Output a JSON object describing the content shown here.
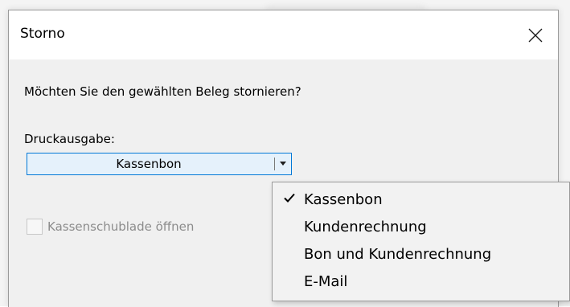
{
  "dialog": {
    "title": "Storno",
    "close_icon": "close-icon",
    "question": "Möchten Sie den gewählten Beleg stornieren?",
    "print_output_label": "Druckausgabe:",
    "print_output": {
      "selected": "Kassenbon",
      "options": [
        "Kassenbon",
        "Kundenrechnung",
        "Bon und Kundenrechnung",
        "E-Mail"
      ],
      "checked_index": 0,
      "arrow_icon": "chevron-down-icon",
      "check_icon": "checkmark-icon"
    },
    "cash_drawer": {
      "label": "Kassenschublade öffnen",
      "checked": false,
      "enabled": false
    }
  },
  "colors": {
    "titlebar": "#ffffff",
    "dialog_bg": "#f0f0f0",
    "combo_bg": "#e5f1fb",
    "combo_border": "#0078d7",
    "disabled_text": "#8c8c8c",
    "menu_bg": "#f2f2f2"
  }
}
